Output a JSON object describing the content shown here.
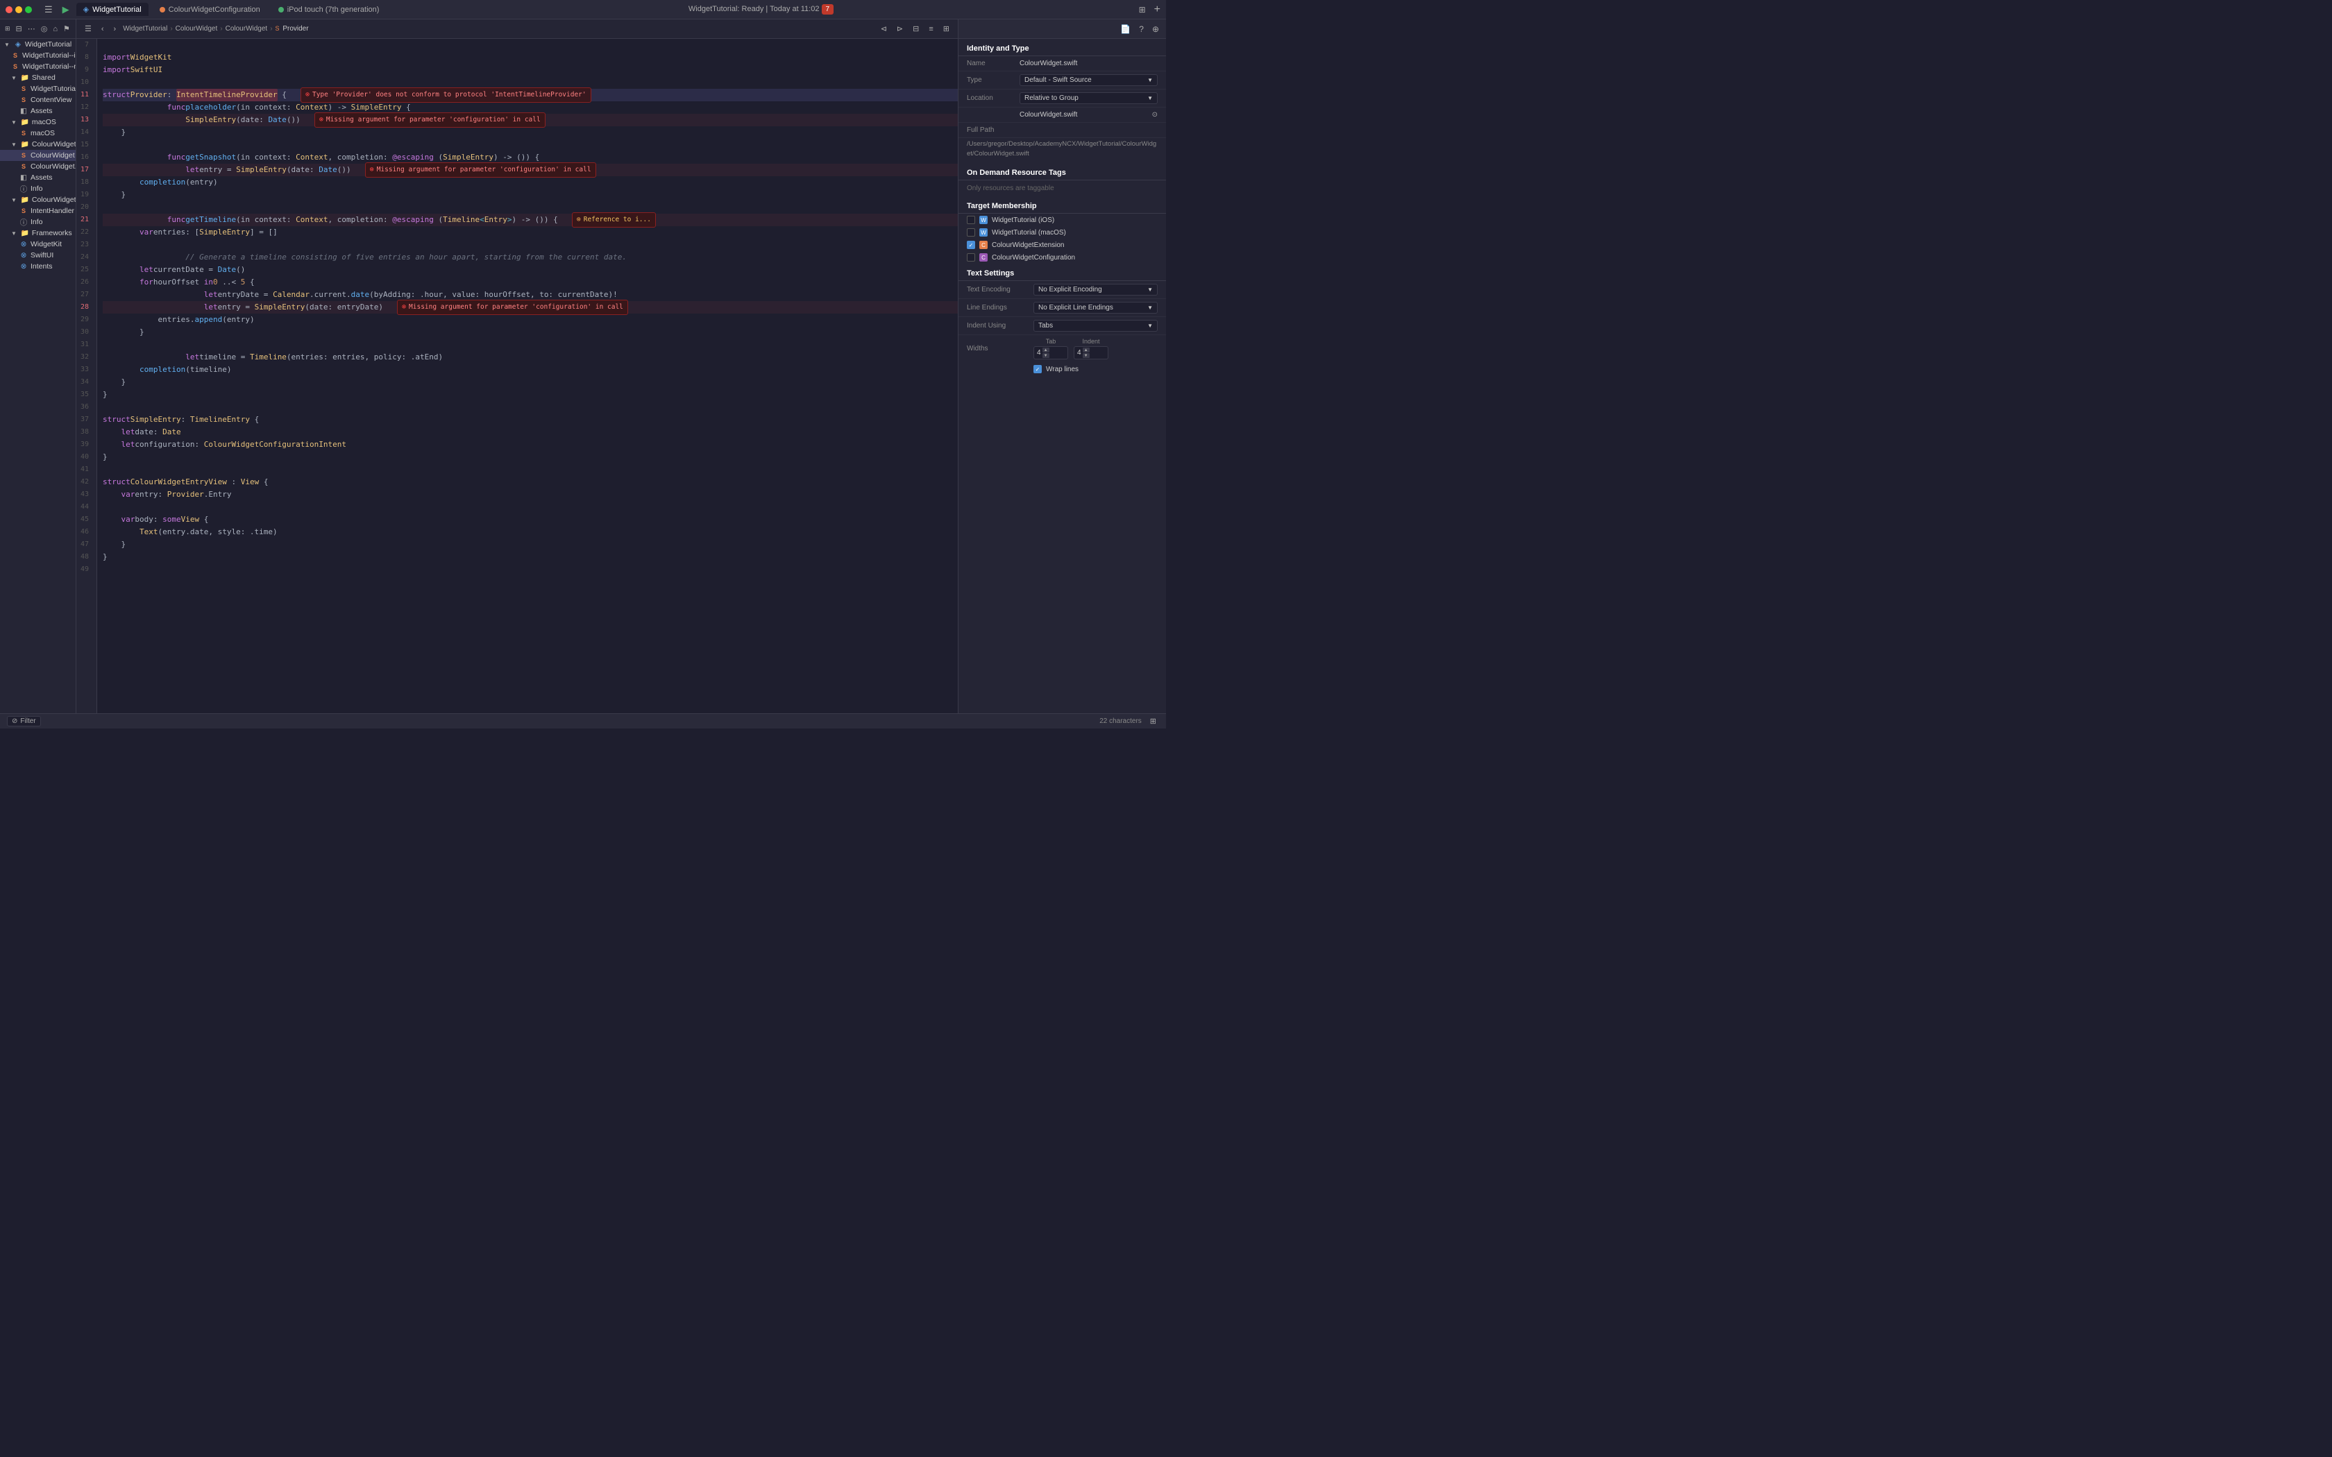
{
  "titlebar": {
    "project_name": "WidgetTutorial",
    "tabs": [
      {
        "label": "ColourWidgetConfiguration",
        "type": "swift",
        "active": false
      },
      {
        "label": "iPod touch (7th generation)",
        "type": "device",
        "active": false
      }
    ],
    "status": "WidgetTutorial: Ready | Today at 11:02",
    "error_count": "7",
    "add_tab": "+"
  },
  "toolbar": {
    "breadcrumbs": [
      "WidgetTutorial",
      "ColourWidget",
      "ColourWidget",
      "Provider"
    ],
    "nav_back": "‹",
    "nav_fwd": "›"
  },
  "sidebar": {
    "items": [
      {
        "label": "WidgetTutorial",
        "indent": 0,
        "type": "project",
        "expanded": true
      },
      {
        "label": "WidgetTutorial--iOS--Info",
        "indent": 1,
        "type": "swift"
      },
      {
        "label": "WidgetTutorial--macOS--Info",
        "indent": 1,
        "type": "swift"
      },
      {
        "label": "Shared",
        "indent": 1,
        "type": "folder",
        "expanded": true
      },
      {
        "label": "WidgetTutorialApp",
        "indent": 2,
        "type": "swift"
      },
      {
        "label": "ContentView",
        "indent": 2,
        "type": "swift"
      },
      {
        "label": "Assets",
        "indent": 2,
        "type": "assets"
      },
      {
        "label": "macOS",
        "indent": 1,
        "type": "folder",
        "expanded": true
      },
      {
        "label": "macOS",
        "indent": 2,
        "type": "swift"
      },
      {
        "label": "ColourWidget",
        "indent": 1,
        "type": "folder",
        "expanded": true
      },
      {
        "label": "ColourWidget",
        "indent": 2,
        "type": "swift",
        "selected": true
      },
      {
        "label": "ColourWidget...urationIntent",
        "indent": 2,
        "type": "swift"
      },
      {
        "label": "Assets",
        "indent": 2,
        "type": "assets"
      },
      {
        "label": "Info",
        "indent": 2,
        "type": "info"
      },
      {
        "label": "ColourWidgetConfiguration",
        "indent": 1,
        "type": "folder",
        "expanded": true
      },
      {
        "label": "IntentHandler",
        "indent": 2,
        "type": "swift"
      },
      {
        "label": "Info",
        "indent": 2,
        "type": "info"
      },
      {
        "label": "Frameworks",
        "indent": 1,
        "type": "folder",
        "expanded": true
      },
      {
        "label": "WidgetKit",
        "indent": 2,
        "type": "framework"
      },
      {
        "label": "SwiftUI",
        "indent": 2,
        "type": "framework"
      },
      {
        "label": "Intents",
        "indent": 2,
        "type": "framework"
      }
    ],
    "filter_placeholder": "Filter"
  },
  "editor": {
    "filename": "ColourWidget.swift",
    "lines": [
      {
        "num": 7,
        "content": ""
      },
      {
        "num": 8,
        "content": "import WidgetKit"
      },
      {
        "num": 9,
        "content": "import SwiftUI"
      },
      {
        "num": 10,
        "content": ""
      },
      {
        "num": 11,
        "content": "struct Provider: IntentTimelineProvider {",
        "error": "Type 'Provider' does not conform to protocol 'IntentTimelineProvider'"
      },
      {
        "num": 12,
        "content": "    func placeholder(in context: Context) -> SimpleEntry {"
      },
      {
        "num": 13,
        "content": "        SimpleEntry(date: Date())",
        "warning": "Missing argument for parameter 'configuration' in call"
      },
      {
        "num": 14,
        "content": "    }"
      },
      {
        "num": 15,
        "content": ""
      },
      {
        "num": 16,
        "content": "    func getSnapshot(in context: Context, completion: @escaping (SimpleEntry) -> ()) {"
      },
      {
        "num": 17,
        "content": "        let entry = SimpleEntry(date: Date())",
        "warning": "Missing argument for parameter 'configuration' in call"
      },
      {
        "num": 18,
        "content": "        completion(entry)"
      },
      {
        "num": 19,
        "content": "    }"
      },
      {
        "num": 20,
        "content": ""
      },
      {
        "num": 21,
        "content": "    func getTimeline(in context: Context, completion: @escaping (Timeline<Entry>) -> ()) {",
        "error": "Reference to i..."
      },
      {
        "num": 22,
        "content": "        var entries: [SimpleEntry] = []"
      },
      {
        "num": 23,
        "content": ""
      },
      {
        "num": 24,
        "content": "        // Generate a timeline consisting of five entries an hour apart, starting from the current date."
      },
      {
        "num": 25,
        "content": "        let currentDate = Date()"
      },
      {
        "num": 26,
        "content": "        for hourOffset in 0 ..< 5 {"
      },
      {
        "num": 27,
        "content": "            let entryDate = Calendar.current.date(byAdding: .hour, value: hourOffset, to: currentDate)!"
      },
      {
        "num": 28,
        "content": "            let entry = SimpleEntry(date: entryDate)",
        "warning": "Missing argument for parameter 'configuration' in call"
      },
      {
        "num": 29,
        "content": "            entries.append(entry)"
      },
      {
        "num": 30,
        "content": "        }"
      },
      {
        "num": 31,
        "content": ""
      },
      {
        "num": 32,
        "content": "        let timeline = Timeline(entries: entries, policy: .atEnd)"
      },
      {
        "num": 33,
        "content": "        completion(timeline)"
      },
      {
        "num": 34,
        "content": "    }"
      },
      {
        "num": 35,
        "content": "}"
      },
      {
        "num": 36,
        "content": ""
      },
      {
        "num": 37,
        "content": "struct SimpleEntry: TimelineEntry {"
      },
      {
        "num": 38,
        "content": "    let date: Date"
      },
      {
        "num": 39,
        "content": "    let configuration: ColourWidgetConfigurationIntent"
      },
      {
        "num": 40,
        "content": "}"
      },
      {
        "num": 41,
        "content": ""
      },
      {
        "num": 42,
        "content": "struct ColourWidgetEntryView : View {"
      },
      {
        "num": 43,
        "content": "    var entry: Provider.Entry"
      },
      {
        "num": 44,
        "content": ""
      },
      {
        "num": 45,
        "content": "    var body: some View {"
      },
      {
        "num": 46,
        "content": "        Text(entry.date, style: .time)"
      },
      {
        "num": 47,
        "content": "    }"
      },
      {
        "num": 48,
        "content": "}"
      },
      {
        "num": 49,
        "content": ""
      }
    ]
  },
  "right_panel": {
    "title": "Identity and Type",
    "name_label": "Name",
    "name_value": "ColourWidget.swift",
    "type_label": "Type",
    "type_value": "Default - Swift Source",
    "location_label": "Location",
    "location_value": "Relative to Group",
    "location_filename": "ColourWidget.swift",
    "full_path_label": "Full Path",
    "full_path_value": "/Users/gregor/Desktop/AcademyNCX/WidgetTutorial/ColourWidget/ColourWidget.swift",
    "on_demand_section": "On Demand Resource Tags",
    "on_demand_placeholder": "Only resources are taggable",
    "target_membership_section": "Target Membership",
    "targets": [
      {
        "name": "WidgetTutorial (iOS)",
        "checked": false,
        "icon": "blue"
      },
      {
        "name": "WidgetTutorial (macOS)",
        "checked": false,
        "icon": "blue"
      },
      {
        "name": "ColourWidgetExtension",
        "checked": true,
        "icon": "orange"
      },
      {
        "name": "ColourWidgetConfiguration",
        "checked": false,
        "icon": "purple"
      }
    ],
    "text_settings_section": "Text Settings",
    "encoding_label": "Text Encoding",
    "encoding_value": "No Explicit Encoding",
    "line_endings_label": "Line Endings",
    "line_endings_value": "No Explicit Line Endings",
    "indent_using_label": "Indent Using",
    "indent_using_value": "Tabs",
    "widths_label": "Widths",
    "tab_label": "Tab",
    "tab_value": "4",
    "indent_label2": "Indent",
    "indent_value2": "4",
    "wrap_label": "Wrap lines"
  },
  "status_bar": {
    "filter_label": "Filter",
    "char_count": "22 characters",
    "expand_icon": "⊞"
  }
}
